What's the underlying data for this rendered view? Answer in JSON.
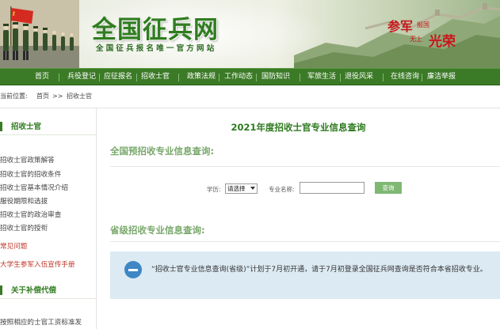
{
  "header": {
    "title": "全国征兵网",
    "subtitle": "全国征兵报名唯一官方网站",
    "slogan": {
      "part1": "参军",
      "part2": "报国",
      "part3": "无上",
      "part4": "光荣"
    }
  },
  "nav": {
    "items": [
      "首页",
      "兵役登记",
      "应征报名",
      "招收士官",
      "政策法规",
      "工作动态",
      "国防知识",
      "军旅生活",
      "退役风采",
      "在线咨询",
      "廉洁举报"
    ]
  },
  "breadcrumb": {
    "label": "当前位置:",
    "home": "首页",
    "separator": ">>",
    "current": "招收士官"
  },
  "sidebar": {
    "section1": {
      "title": "招收士官",
      "items": [
        "招收士官政策解答",
        "招收士官的招收条件",
        "招收士官基本情况介绍",
        "服役期限和选拔",
        "招收士官的政治审查",
        "招收士官的授衔"
      ],
      "faq": "常见问题",
      "manual": "大学生参军入伍宣传手册"
    },
    "section2": {
      "title": "关于补偿代偿",
      "items": [
        "按照相应的士官工资标准发"
      ]
    }
  },
  "main": {
    "page_title": "2021年度招收士官专业信息查询",
    "national_title": "全国预招收专业信息查询:",
    "provincial_title": "省级招收专业信息查询:",
    "form": {
      "education_label": "学历:",
      "education_value": "请选择",
      "major_label": "专业名称:",
      "major_value": "",
      "query_button": "查询"
    },
    "notice": "“招收士官专业信息查询(省级)”计划于7月初开通，请于7月初登录全国征兵网查询是否符合本省招收专业。"
  },
  "colors": {
    "brand_green": "#3b7a26",
    "title_green": "#2e7a1f",
    "notice_bg": "#dceaf3",
    "notice_icon": "#3f86c4",
    "slogan_red": "#c8161d"
  }
}
